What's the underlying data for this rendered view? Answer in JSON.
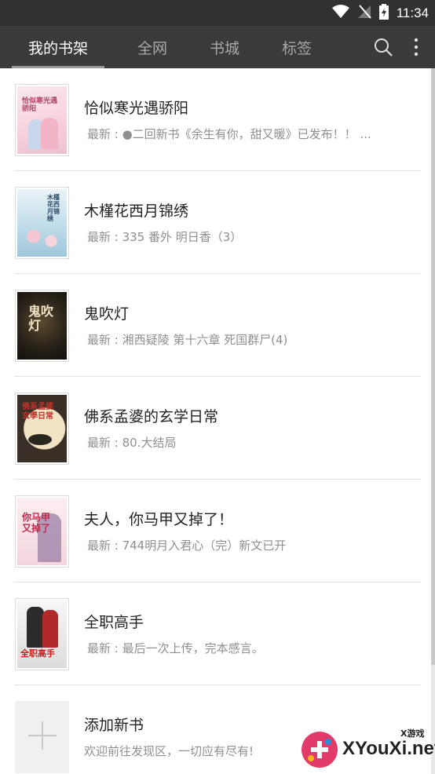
{
  "status_bar": {
    "time": "11:34",
    "icons": [
      "wifi-icon",
      "signal-off-icon",
      "battery-charging-icon"
    ]
  },
  "tabs": [
    {
      "label": "我的书架",
      "active": true
    },
    {
      "label": "全网",
      "active": false
    },
    {
      "label": "书城",
      "active": false
    },
    {
      "label": "标签",
      "active": false
    }
  ],
  "actions": {
    "search_icon": "search-icon",
    "more_icon": "more-vertical-icon"
  },
  "books": [
    {
      "title": "恰似寒光遇骄阳",
      "latest": "最新 : ●二回新书《余生有你，甜又暖》已发布！！ ...",
      "cover_text": "恰似寒光遇骄阳"
    },
    {
      "title": "木槿花西月锦绣",
      "latest": "最新 : 335 番外 明日香（3）",
      "cover_text": "木槿花西月锦绣"
    },
    {
      "title": "鬼吹灯",
      "latest": "最新 : 湘西疑陵 第十六章 死国群尸(4)",
      "cover_text": "鬼吹灯"
    },
    {
      "title": "佛系孟婆的玄学日常",
      "latest": "最新 : 80.大结局",
      "cover_text": "佛系孟婆 玄學日常"
    },
    {
      "title": "夫人，你马甲又掉了！",
      "latest": "最新 : 744明月入君心（完）新文已开",
      "cover_text": "你马甲又掉了"
    },
    {
      "title": "全职高手",
      "latest": "最新 : 最后一次上传，完本感言。",
      "cover_text": "全职高手"
    }
  ],
  "add_book": {
    "title": "添加新书",
    "subtitle": "欢迎前往发现区，一切应有尽有!"
  },
  "watermark": {
    "text": "XYouXi.net",
    "small": "X游戏"
  }
}
